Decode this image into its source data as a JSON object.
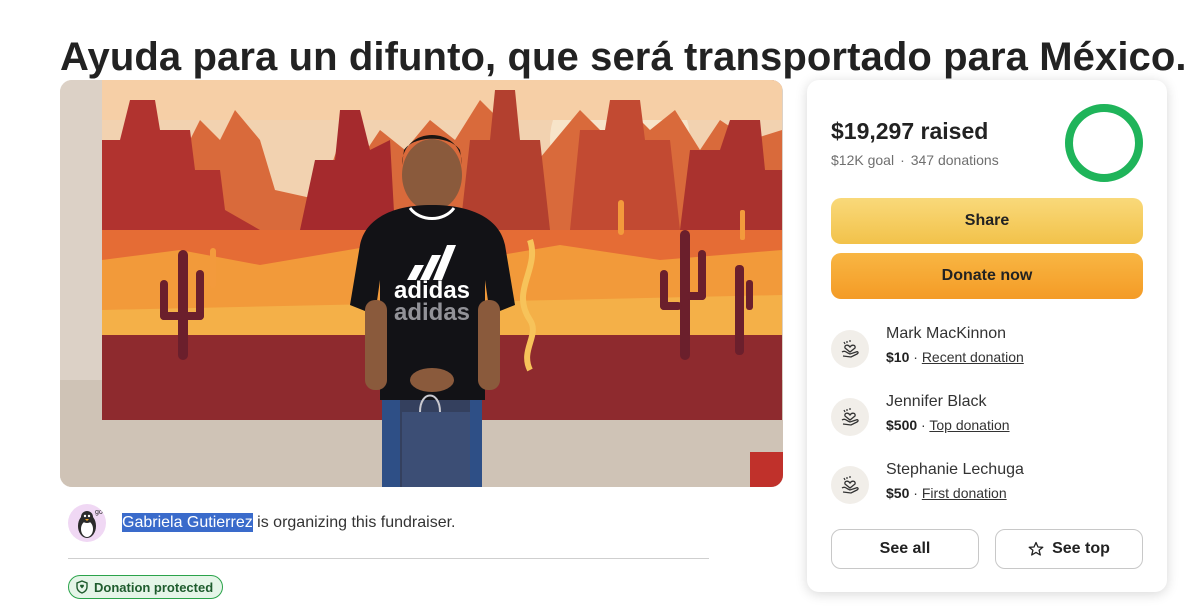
{
  "campaign": {
    "title": "Ayuda para un difunto, que será transportado para México.",
    "image_alt": "Photo of a boy in a black adidas shirt holding a gift bag in front of a desert mural",
    "shirt_logo_text": "adidas"
  },
  "organizer": {
    "name": "Gabriela Gutierrez",
    "suffix": " is organizing this fundraiser."
  },
  "badge": {
    "label": "Donation protected",
    "color": "#2aa34a"
  },
  "stats": {
    "raised": "$19,297 raised",
    "goal": "$12K goal",
    "separator": "·",
    "donations": "347 donations",
    "progress": 1.0
  },
  "actions": {
    "share_label": "Share",
    "donate_label": "Donate now"
  },
  "donations": [
    {
      "name": "Mark MacKinnon",
      "amount": "$10",
      "sep": " · ",
      "tag": "Recent donation",
      "icon": "heart-hands-icon"
    },
    {
      "name": "Jennifer Black",
      "amount": "$500",
      "sep": " · ",
      "tag": "Top donation",
      "icon": "heart-hands-icon"
    },
    {
      "name": "Stephanie Lechuga",
      "amount": "$50",
      "sep": " · ",
      "tag": "First donation",
      "icon": "heart-hands-icon"
    }
  ],
  "footer_buttons": {
    "see_all": "See all",
    "see_top": "See top"
  },
  "colors": {
    "share_button": "#f2c24a",
    "donate_button": "#f49b26",
    "progress_green": "#1fb45a",
    "selection_highlight": "#3a6bcb"
  }
}
